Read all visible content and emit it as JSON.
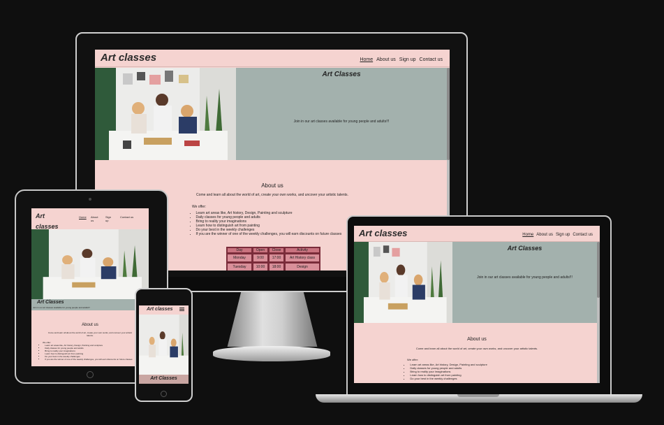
{
  "site": {
    "logo": "Art classes",
    "logo_line1": "Art",
    "logo_line2": "classes",
    "nav": [
      "Home",
      "About us",
      "Sign up",
      "Contact us"
    ],
    "hero_title": "Art Classes",
    "hero_text": "Join in our art classes available for young people and adults!!!",
    "about_title": "About us",
    "about_text": "Come and learn all about the world of art, create your own works, and uncover your artistic talents.",
    "offer_title": "We offer:",
    "offer_items": [
      "Learn art areas like, Art history, Design, Painting and sculpture",
      "Daily classes for young people and adults",
      "Bring to reality your imaginations",
      "Learn how to distinguish art from painting",
      "Do your best in the weekly challenges",
      "If you are the winner of one of the weekly challenges, you will earn discounts on future classes"
    ],
    "table": {
      "headers": [
        "Day",
        "Open",
        "Close",
        "Activity"
      ],
      "rows": [
        [
          "Monday",
          "9:00",
          "17:00",
          "Art History class"
        ],
        [
          "Tuesday",
          "10:00",
          "18:00",
          "Design"
        ]
      ]
    }
  },
  "colors": {
    "background": "#0f0f0f",
    "site_pink": "#f5d3d0",
    "hero_sage": "#a3b1ad",
    "table_cell": "#d98f99",
    "table_border": "#7a2c3a"
  },
  "icons": {
    "menu": "hamburger-icon"
  }
}
